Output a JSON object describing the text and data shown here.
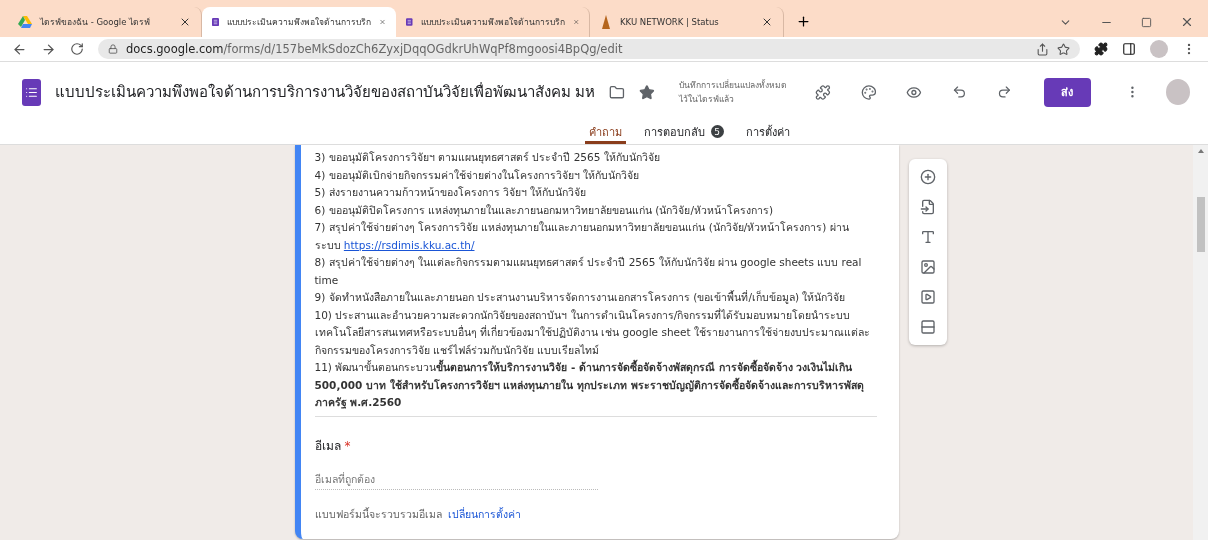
{
  "browser": {
    "tabs": [
      {
        "kind": "drive",
        "title": "ไดรฟ์ของฉัน - Google ไดรฟ์",
        "selected": false
      },
      {
        "kind": "forms",
        "title": "แบบประเมินความพึงพอใจด้านการบริก",
        "selected": true
      },
      {
        "kind": "forms",
        "title": "แบบประเมินความพึงพอใจด้านการบริก",
        "selected": false
      },
      {
        "kind": "site",
        "title": "KKU NETWORK | Status",
        "selected": false
      }
    ],
    "address": {
      "host": "docs.google.com",
      "path": "/forms/d/157beMkSdozCh6ZyxjDqqOGdkrUhWqPf8mgoosi4BpQg/edit"
    }
  },
  "form_header": {
    "title": "แบบประเมินความพึงพอใจด้านการบริการงานวิจัยของสถาบันวิจัยเพื่อพัฒนาสังคม มห",
    "save_status": [
      "บันทึกการเปลี่ยนแปลงทั้งหมด",
      "ไว้ในไดรฟ์แล้ว"
    ],
    "send_button": "ส่ง"
  },
  "nav_tabs": [
    {
      "label": "คำถาม",
      "selected": true
    },
    {
      "label": "การตอบกลับ",
      "badge": "5",
      "selected": false
    },
    {
      "label": "การตั้งค่า",
      "selected": false
    }
  ],
  "description": [
    {
      "text": "3) ขออนุมัติโครงการวิจัยฯ ตามแผนยุทธศาสตร์ ประจำปี 2565 ให้กับนักวิจัย"
    },
    {
      "text": "4) ขออนุมัติเบิกจ่ายกิจกรรมค่าใช้จ่ายต่างในโครงการวิจัยฯ ให้กับนักวิจัย"
    },
    {
      "text": "5) ส่งรายงานความก้าวหน้าของโครงการ วิจัยฯ ให้กับนักวิจัย"
    },
    {
      "text": "6) ขออนุมัติปิดโครงการ แหล่งทุนภายในและภายนอกมหาวิทยาลัยขอนแก่น (นักวิจัย/หัวหน้าโครงการ)"
    },
    {
      "text": "7) สรุปค่าใช้จ่ายต่างๆ โครงการวิจัย แหล่งทุนภายในและภายนอกมหาวิทยาลัยขอนแก่น (นักวิจัย/หัวหน้าโครงการ) ผ่าน ระบบ",
      "link": "https://rsdimis.kku.ac.th/"
    },
    {
      "text": "8) สรุปค่าใช้จ่ายต่างๆ ในแต่ละกิจกรรมตามแผนยุทธศาสตร์ ประจำปี 2565 ให้กับนักวิจัย ผ่าน google sheets แบบ real time"
    },
    {
      "text": "9) จัดทำหนังสือภายในและภายนอก ประสานงานบริหารจัดการงานเอกสารโครงการ (ขอเข้าพื้นที่/เก็บข้อมูล) ให้นักวิจัย"
    },
    {
      "text": "10) ประสานและอำนวยความสะดวกนักวิจัยของสถาบันฯ ในการดำเนินโครงการ/กิจกรรมที่ได้รับมอบหมายโดยนำระบบเทคโนโลยีสารสนเทศหรือระบบอื่นๆ ที่เกี่ยวข้องมาใช้ปฏิบัติงาน เช่น google sheet ใช้รายงานการใช้จ่ายงบประมาณแต่ละกิจกรรมของโครงการวิจัย แชร์ไฟล์ร่วมกับนักวิจัย แบบเรียลไทม์"
    },
    {
      "text": "11) พัฒนาขั้นตอนกระบวน**ขั้นตอนการให้บริการงานวิจัย - ด้านการจัดซื้อจัดจ้างพัสดุกรณี การจัดซื้อจัดจ้าง วงเงินไม่เกิน 500,000 บาท  ใช้สำหรับโครงการวิจัยฯ แหล่งทุนภายใน ทุกประเภท พระราชบัญญัติการจัดซื้อจัดจ้างและการบริหารพัสดุภาครัฐ พ.ศ.2560**"
    }
  ],
  "email": {
    "label": "อีเมล",
    "required_mark": "*",
    "placeholder": "อีเมลที่ถูกต้อง",
    "note": "แบบฟอร์มนี้จะรวบรวมอีเมล",
    "link": "เปลี่ยนการตั้งค่า"
  }
}
